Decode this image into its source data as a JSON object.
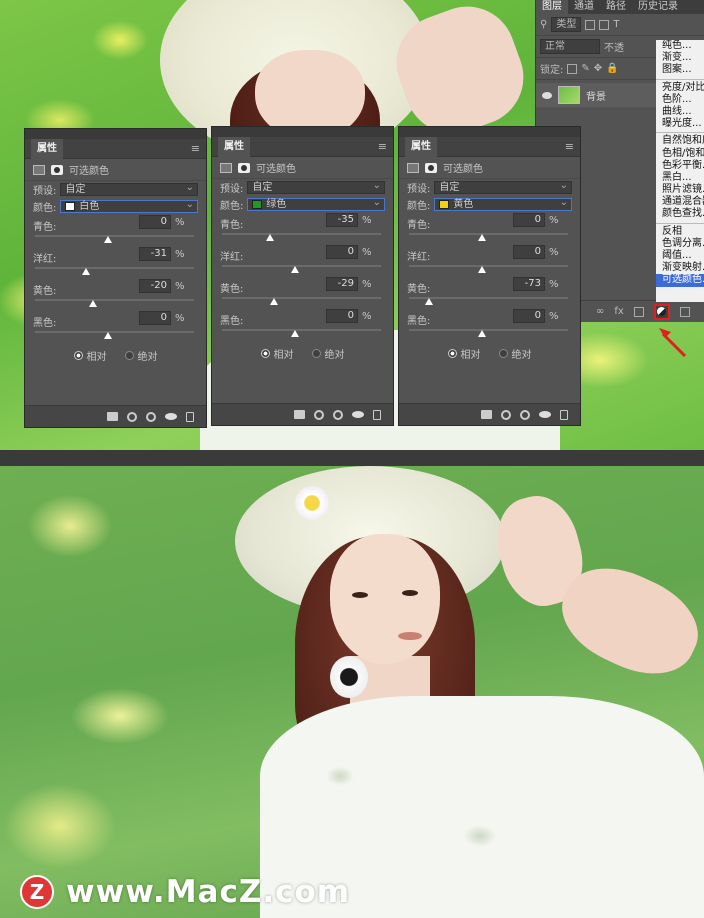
{
  "layers_panel": {
    "tabs": [
      "图层",
      "通道",
      "路径",
      "历史记录"
    ],
    "filter_label": "类型",
    "blend_mode": "正常",
    "opacity_label": "不透",
    "lock_label": "锁定:",
    "layer_name": "背景"
  },
  "adjust_menu": {
    "groups": [
      [
        "纯色...",
        "渐变...",
        "图案..."
      ],
      [
        "亮度/对比度...",
        "色阶...",
        "曲线...",
        "曝光度..."
      ],
      [
        "自然饱和度...",
        "色相/饱和度...",
        "色彩平衡...",
        "黑白...",
        "照片滤镜...",
        "通道混合器...",
        "颜色查找..."
      ],
      [
        "反相",
        "色调分离...",
        "阈值...",
        "渐变映射...",
        "可选颜色..."
      ]
    ],
    "selected": "可选颜色..."
  },
  "properties_panels": [
    {
      "tab": "属性",
      "title": "可选颜色",
      "preset_label": "预设:",
      "preset_value": "自定",
      "color_label": "颜色:",
      "color_value": "白色",
      "swatch": "#ffffff",
      "sliders": [
        {
          "label": "青色:",
          "value": "0",
          "pos": 0.5
        },
        {
          "label": "洋红:",
          "value": "-31",
          "pos": 0.35
        },
        {
          "label": "黄色:",
          "value": "-20",
          "pos": 0.4
        },
        {
          "label": "黑色:",
          "value": "0",
          "pos": 0.5
        }
      ],
      "radio_relative": "相对",
      "radio_absolute": "绝对"
    },
    {
      "tab": "属性",
      "title": "可选颜色",
      "preset_label": "预设:",
      "preset_value": "自定",
      "color_label": "颜色:",
      "color_value": "绿色",
      "swatch": "#1f9a1f",
      "sliders": [
        {
          "label": "青色:",
          "value": "-35",
          "pos": 0.33
        },
        {
          "label": "洋红:",
          "value": "0",
          "pos": 0.5
        },
        {
          "label": "黄色:",
          "value": "-29",
          "pos": 0.36
        },
        {
          "label": "黑色:",
          "value": "0",
          "pos": 0.5
        }
      ],
      "radio_relative": "相对",
      "radio_absolute": "绝对"
    },
    {
      "tab": "属性",
      "title": "可选颜色",
      "preset_label": "预设:",
      "preset_value": "自定",
      "color_label": "颜色:",
      "color_value": "黄色",
      "swatch": "#f2d20a",
      "sliders": [
        {
          "label": "青色:",
          "value": "0",
          "pos": 0.5
        },
        {
          "label": "洋红:",
          "value": "0",
          "pos": 0.5
        },
        {
          "label": "黄色:",
          "value": "-73",
          "pos": 0.14
        },
        {
          "label": "黑色:",
          "value": "0",
          "pos": 0.5
        }
      ],
      "radio_relative": "相对",
      "radio_absolute": "绝对"
    }
  ],
  "percent_sign": "%",
  "watermark": {
    "logo": "Z",
    "text": "www.MacZ.com"
  }
}
